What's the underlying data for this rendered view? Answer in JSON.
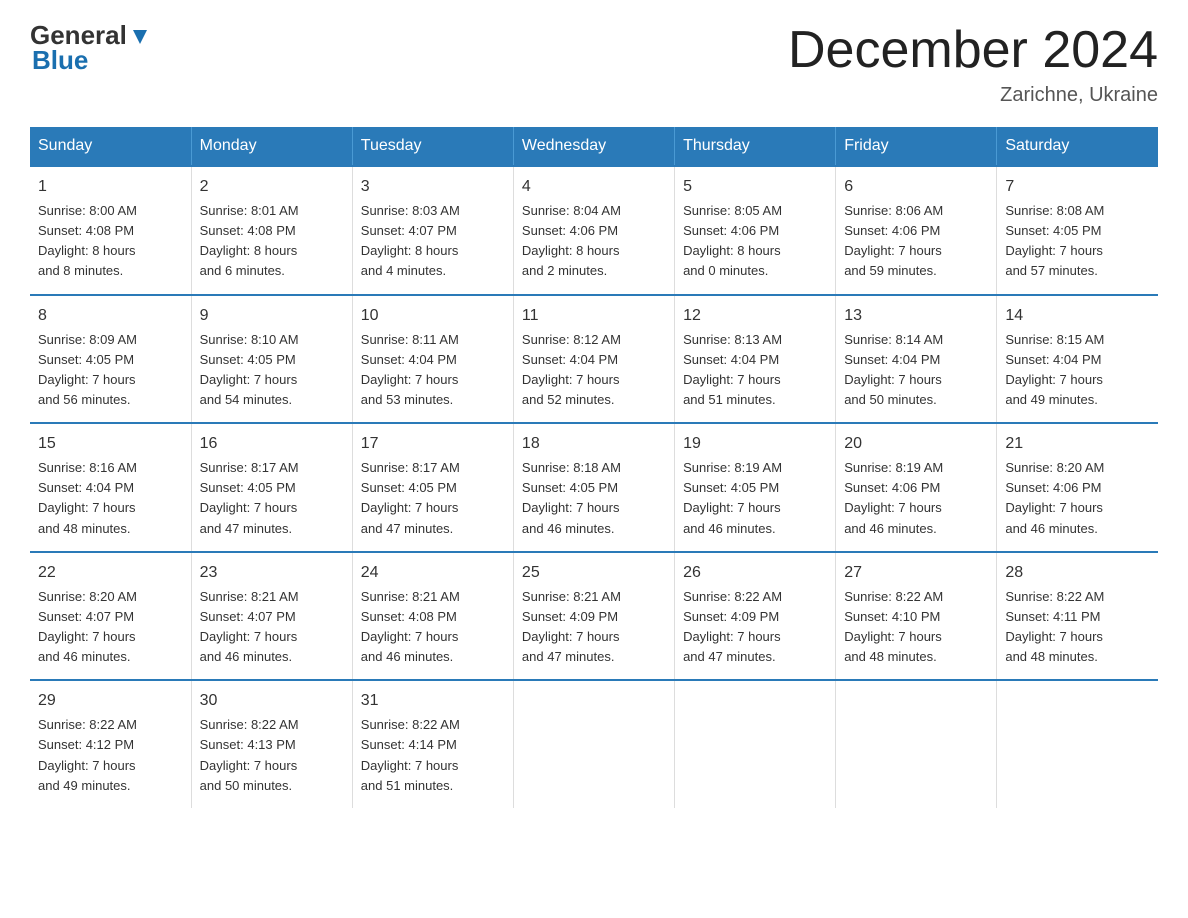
{
  "header": {
    "logo_line1": "General",
    "logo_line2": "Blue",
    "title": "December 2024",
    "subtitle": "Zarichne, Ukraine"
  },
  "weekdays": [
    "Sunday",
    "Monday",
    "Tuesday",
    "Wednesday",
    "Thursday",
    "Friday",
    "Saturday"
  ],
  "weeks": [
    [
      {
        "day": "1",
        "info": "Sunrise: 8:00 AM\nSunset: 4:08 PM\nDaylight: 8 hours\nand 8 minutes."
      },
      {
        "day": "2",
        "info": "Sunrise: 8:01 AM\nSunset: 4:08 PM\nDaylight: 8 hours\nand 6 minutes."
      },
      {
        "day": "3",
        "info": "Sunrise: 8:03 AM\nSunset: 4:07 PM\nDaylight: 8 hours\nand 4 minutes."
      },
      {
        "day": "4",
        "info": "Sunrise: 8:04 AM\nSunset: 4:06 PM\nDaylight: 8 hours\nand 2 minutes."
      },
      {
        "day": "5",
        "info": "Sunrise: 8:05 AM\nSunset: 4:06 PM\nDaylight: 8 hours\nand 0 minutes."
      },
      {
        "day": "6",
        "info": "Sunrise: 8:06 AM\nSunset: 4:06 PM\nDaylight: 7 hours\nand 59 minutes."
      },
      {
        "day": "7",
        "info": "Sunrise: 8:08 AM\nSunset: 4:05 PM\nDaylight: 7 hours\nand 57 minutes."
      }
    ],
    [
      {
        "day": "8",
        "info": "Sunrise: 8:09 AM\nSunset: 4:05 PM\nDaylight: 7 hours\nand 56 minutes."
      },
      {
        "day": "9",
        "info": "Sunrise: 8:10 AM\nSunset: 4:05 PM\nDaylight: 7 hours\nand 54 minutes."
      },
      {
        "day": "10",
        "info": "Sunrise: 8:11 AM\nSunset: 4:04 PM\nDaylight: 7 hours\nand 53 minutes."
      },
      {
        "day": "11",
        "info": "Sunrise: 8:12 AM\nSunset: 4:04 PM\nDaylight: 7 hours\nand 52 minutes."
      },
      {
        "day": "12",
        "info": "Sunrise: 8:13 AM\nSunset: 4:04 PM\nDaylight: 7 hours\nand 51 minutes."
      },
      {
        "day": "13",
        "info": "Sunrise: 8:14 AM\nSunset: 4:04 PM\nDaylight: 7 hours\nand 50 minutes."
      },
      {
        "day": "14",
        "info": "Sunrise: 8:15 AM\nSunset: 4:04 PM\nDaylight: 7 hours\nand 49 minutes."
      }
    ],
    [
      {
        "day": "15",
        "info": "Sunrise: 8:16 AM\nSunset: 4:04 PM\nDaylight: 7 hours\nand 48 minutes."
      },
      {
        "day": "16",
        "info": "Sunrise: 8:17 AM\nSunset: 4:05 PM\nDaylight: 7 hours\nand 47 minutes."
      },
      {
        "day": "17",
        "info": "Sunrise: 8:17 AM\nSunset: 4:05 PM\nDaylight: 7 hours\nand 47 minutes."
      },
      {
        "day": "18",
        "info": "Sunrise: 8:18 AM\nSunset: 4:05 PM\nDaylight: 7 hours\nand 46 minutes."
      },
      {
        "day": "19",
        "info": "Sunrise: 8:19 AM\nSunset: 4:05 PM\nDaylight: 7 hours\nand 46 minutes."
      },
      {
        "day": "20",
        "info": "Sunrise: 8:19 AM\nSunset: 4:06 PM\nDaylight: 7 hours\nand 46 minutes."
      },
      {
        "day": "21",
        "info": "Sunrise: 8:20 AM\nSunset: 4:06 PM\nDaylight: 7 hours\nand 46 minutes."
      }
    ],
    [
      {
        "day": "22",
        "info": "Sunrise: 8:20 AM\nSunset: 4:07 PM\nDaylight: 7 hours\nand 46 minutes."
      },
      {
        "day": "23",
        "info": "Sunrise: 8:21 AM\nSunset: 4:07 PM\nDaylight: 7 hours\nand 46 minutes."
      },
      {
        "day": "24",
        "info": "Sunrise: 8:21 AM\nSunset: 4:08 PM\nDaylight: 7 hours\nand 46 minutes."
      },
      {
        "day": "25",
        "info": "Sunrise: 8:21 AM\nSunset: 4:09 PM\nDaylight: 7 hours\nand 47 minutes."
      },
      {
        "day": "26",
        "info": "Sunrise: 8:22 AM\nSunset: 4:09 PM\nDaylight: 7 hours\nand 47 minutes."
      },
      {
        "day": "27",
        "info": "Sunrise: 8:22 AM\nSunset: 4:10 PM\nDaylight: 7 hours\nand 48 minutes."
      },
      {
        "day": "28",
        "info": "Sunrise: 8:22 AM\nSunset: 4:11 PM\nDaylight: 7 hours\nand 48 minutes."
      }
    ],
    [
      {
        "day": "29",
        "info": "Sunrise: 8:22 AM\nSunset: 4:12 PM\nDaylight: 7 hours\nand 49 minutes."
      },
      {
        "day": "30",
        "info": "Sunrise: 8:22 AM\nSunset: 4:13 PM\nDaylight: 7 hours\nand 50 minutes."
      },
      {
        "day": "31",
        "info": "Sunrise: 8:22 AM\nSunset: 4:14 PM\nDaylight: 7 hours\nand 51 minutes."
      },
      {
        "day": "",
        "info": ""
      },
      {
        "day": "",
        "info": ""
      },
      {
        "day": "",
        "info": ""
      },
      {
        "day": "",
        "info": ""
      }
    ]
  ]
}
